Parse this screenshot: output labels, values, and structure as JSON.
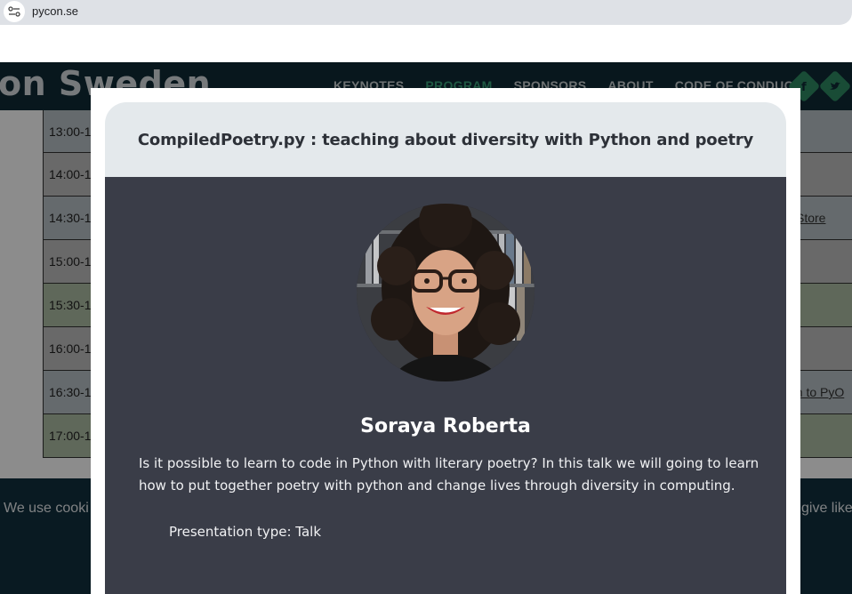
{
  "browser": {
    "url": "pycon.se"
  },
  "site": {
    "brand_partial": "on Sweden",
    "nav": [
      {
        "label": "KEYNOTES",
        "active": false
      },
      {
        "label": "PROGRAM",
        "active": true
      },
      {
        "label": "SPONSORS",
        "active": false
      },
      {
        "label": "ABOUT",
        "active": false
      },
      {
        "label": "CODE OF CONDUCT",
        "active": false
      }
    ]
  },
  "schedule": {
    "rows": [
      {
        "time": "13:00-1",
        "bg": "#b9c2c6",
        "link": ""
      },
      {
        "time": "14:00-1",
        "bg": "#bfbfbf",
        "link": ""
      },
      {
        "time": "14:30-1",
        "bg": "#b9c2c6",
        "link": "Store"
      },
      {
        "time": "15:00-1",
        "bg": "#bfbfbf",
        "link": ""
      },
      {
        "time": "15:30-1",
        "bg": "#aebda4",
        "link": ""
      },
      {
        "time": "16:00-1",
        "bg": "#bfbfbf",
        "link": ""
      },
      {
        "time": "16:30-1",
        "bg": "#b9c2c6",
        "link": "on to PyO"
      },
      {
        "time": "17:00-1",
        "bg": "#aebda4",
        "link": ""
      }
    ]
  },
  "cookie": {
    "text_left": "We use cooki",
    "text_right": "give like"
  },
  "modal": {
    "title": "CompiledPoetry.py : teaching about diversity with Python and poetry",
    "speaker": "Soraya Roberta",
    "abstract": "Is it possible to learn to code in Python with literary poetry? In this talk we will going to learn how to put together poetry with python and change lives through diversity in computing.",
    "presentation_type": "Presentation type: Talk"
  },
  "colors": {
    "header_bg": "#0f2a36",
    "accent": "#39a37a",
    "modal_body": "#3a3d48",
    "modal_head": "#e4e9ec"
  }
}
